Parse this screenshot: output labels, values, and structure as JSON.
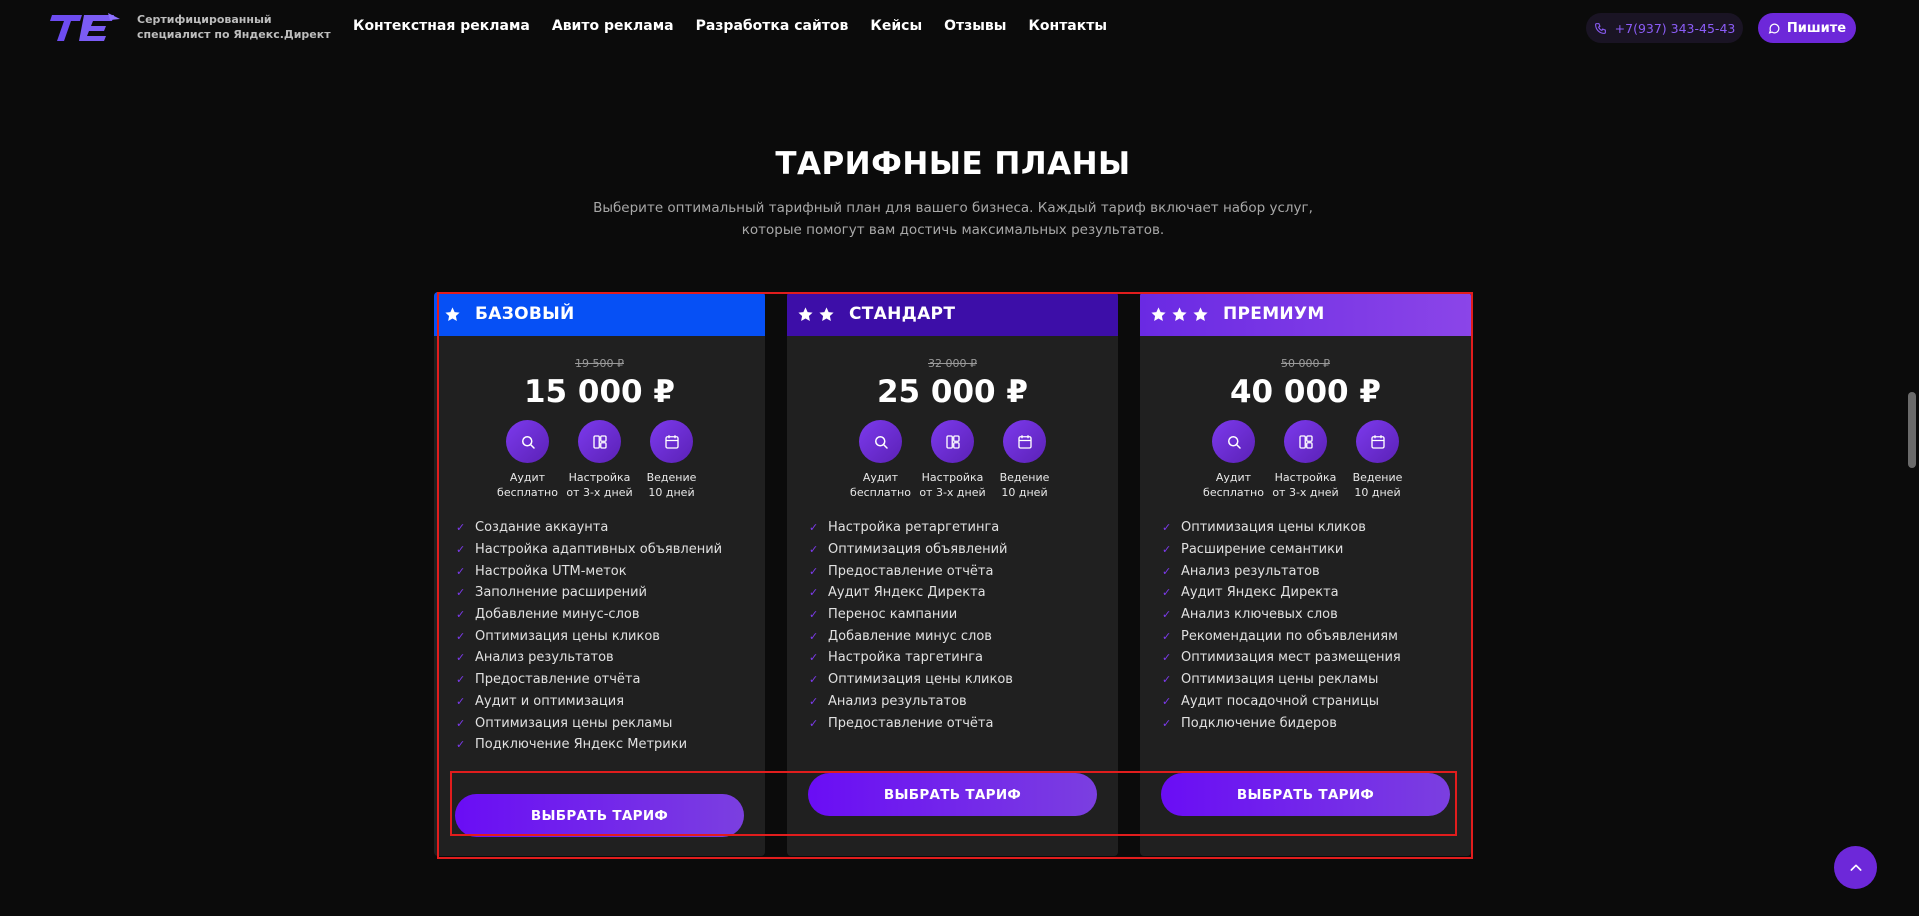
{
  "header": {
    "logo_text": "Сертифицированный специалист по Яндекс.Директ",
    "nav": [
      "Контекстная реклама",
      "Авито реклама",
      "Разработка сайтов",
      "Кейсы",
      "Отзывы",
      "Контакты"
    ],
    "phone": "+7(937) 343-45-43",
    "write_label": "Пишите"
  },
  "section": {
    "title": "ТАРИФНЫЕ ПЛАНЫ",
    "subtitle_line1": "Выберите оптимальный тарифный план для вашего бизнеса. Каждый тариф включает набор услуг,",
    "subtitle_line2": "которые помогут вам достичь максимальных результатов."
  },
  "colors": {
    "base": "#0650f5",
    "standard": "#3d0ea8",
    "premium_from": "#6a2ae3",
    "premium_to": "#8b45e8",
    "accent": "#6d28d9"
  },
  "plans": [
    {
      "name": "БАЗОВЫЙ",
      "stars": 1,
      "old_price": "19 500 ₽",
      "price": "15 000 ₽",
      "features": [
        {
          "line1": "Аудит",
          "line2": "бесплатно"
        },
        {
          "line1": "Настройка",
          "line2": "от 3-х дней"
        },
        {
          "line1": "Ведение",
          "line2": "10 дней"
        }
      ],
      "items": [
        "Создание аккаунта",
        "Настройка адаптивных объявлений",
        "Настройка UTM-меток",
        "Заполнение расширений",
        "Добавление минус-слов",
        "Оптимизация цены кликов",
        "Анализ результатов",
        "Предоставление отчёта",
        "Аудит и оптимизация",
        "Оптимизация цены рекламы",
        "Подключение Яндекс Метрики"
      ],
      "button": "ВЫБРАТЬ ТАРИФ"
    },
    {
      "name": "СТАНДАРТ",
      "stars": 2,
      "old_price": "32 000 ₽",
      "price": "25 000 ₽",
      "features": [
        {
          "line1": "Аудит",
          "line2": "бесплатно"
        },
        {
          "line1": "Настройка",
          "line2": "от 3-х дней"
        },
        {
          "line1": "Ведение",
          "line2": "10 дней"
        }
      ],
      "items": [
        "Настройка ретаргетинга",
        "Оптимизация объявлений",
        "Предоставление отчёта",
        "Аудит Яндекс Директа",
        "Перенос кампании",
        "Добавление минус слов",
        "Настройка таргетинга",
        "Оптимизация цены кликов",
        "Анализ результатов",
        "Предоставление отчёта"
      ],
      "button": "ВЫБРАТЬ ТАРИФ"
    },
    {
      "name": "ПРЕМИУМ",
      "stars": 3,
      "old_price": "50 000 ₽",
      "price": "40 000 ₽",
      "features": [
        {
          "line1": "Аудит",
          "line2": "бесплатно"
        },
        {
          "line1": "Настройка",
          "line2": "от 3-х дней"
        },
        {
          "line1": "Ведение",
          "line2": "10 дней"
        }
      ],
      "items": [
        "Оптимизация цены кликов",
        "Расширение семантики",
        "Анализ результатов",
        "Аудит Яндекс Директа",
        "Анализ ключевых слов",
        "Рекомендации по объявлениям",
        "Оптимизация мест размещения",
        "Оптимизация цены рекламы",
        "Аудит посадочной страницы",
        "Подключение бидеров"
      ],
      "button": "ВЫБРАТЬ ТАРИФ"
    }
  ]
}
